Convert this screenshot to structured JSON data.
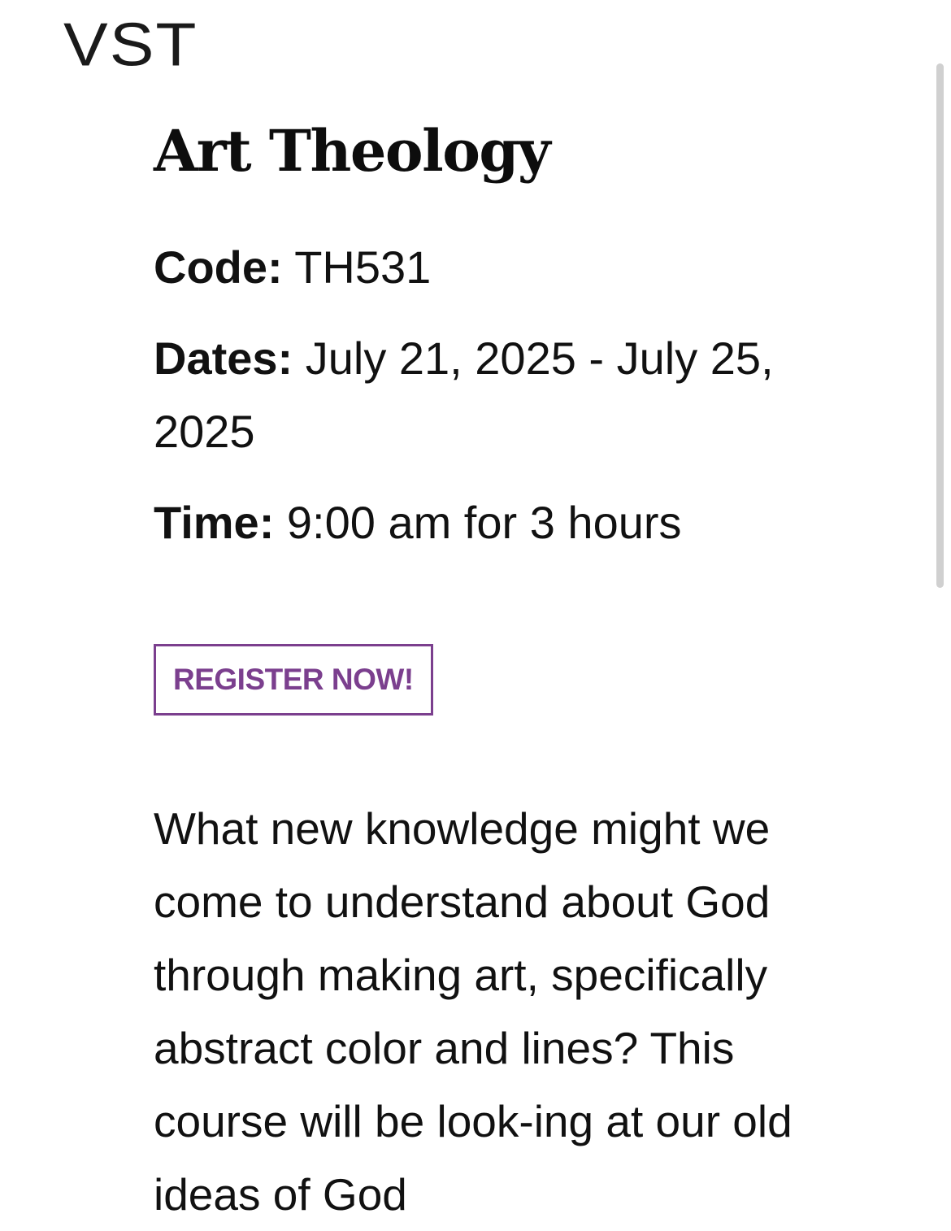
{
  "header": {
    "logo_text": "VST"
  },
  "course": {
    "title": "Art Theology",
    "code_label": "Code:",
    "code_value": "TH531",
    "dates_label": "Dates:",
    "dates_value": "July 21, 2025 - July 25, 2025",
    "time_label": "Time:",
    "time_value": "9:00 am for 3 hours",
    "register_label": "REGISTER NOW!",
    "description": "What new knowledge might we come to understand about God through making art, specifically abstract color and lines? This course will be look-ing at our old ideas of God"
  },
  "colors": {
    "accent": "#7b3f8e",
    "text": "#111111",
    "background": "#ffffff"
  }
}
